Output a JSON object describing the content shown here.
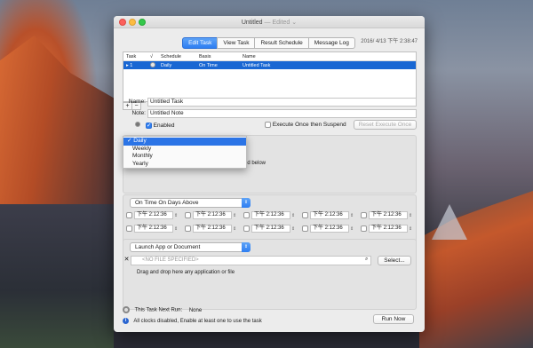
{
  "window": {
    "title": "Untitled",
    "title_suffix": " — Edited ⌄",
    "clock": "2016/ 4/13 下午 2:38:47"
  },
  "tabs": [
    "Edit Task",
    "View Task",
    "Result Schedule",
    "Message Log"
  ],
  "task_table": {
    "headers": [
      "Task",
      "√",
      "Schedule",
      "Basis",
      "Name"
    ],
    "rows": [
      {
        "task": "▸ 1",
        "schedule": "Daily",
        "basis": "On Time",
        "name": "Untitled Task"
      }
    ],
    "add_label": "+",
    "remove_label": "−"
  },
  "form": {
    "name_label": "Name:",
    "name_value": "Untitled Task",
    "note_label": "Note:",
    "note_value": "Untitled Note",
    "enabled_label": "Enabled",
    "execute_once_label": "Execute Once then Suspend",
    "reset_button": "Reset Execute Once"
  },
  "schedule_menu": {
    "items": [
      "Daily",
      "Weekly",
      "Monthly",
      "Yearly"
    ],
    "selected_index": 0,
    "check_mark": "✓",
    "behind_text": "ed below"
  },
  "basis_popup": {
    "value": "On Time On Days Above",
    "arrow": "⇕"
  },
  "times": [
    [
      "下午  2:12:36",
      "下午  2:12:36",
      "下午  2:12:36",
      "下午  2:12:36",
      "下午  2:12:36"
    ],
    [
      "下午  2:12:36",
      "下午  2:12:36",
      "下午  2:12:36",
      "下午  2:12:36",
      "下午  2:12:36"
    ]
  ],
  "action": {
    "popup_value": "Launch App or Document",
    "file_placeholder": "<NO FILE SPECIFIED>",
    "select_button": "Select...",
    "drop_hint": "Drag and drop here any application or file"
  },
  "footer": {
    "next_run_label": "This Task Next Run:",
    "next_run_value": "None",
    "status_message": "All clocks disabled, Enable at least one to use the task",
    "run_now_button": "Run Now"
  }
}
